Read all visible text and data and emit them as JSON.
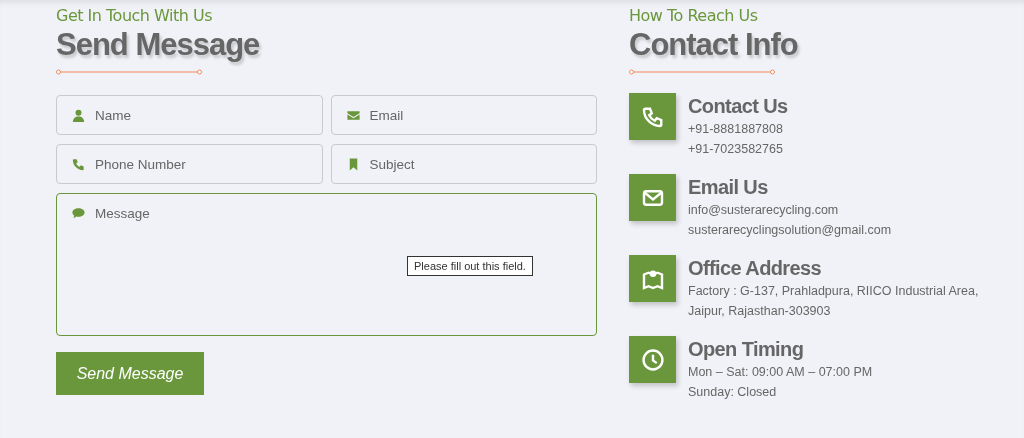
{
  "form": {
    "eyebrow": "Get In Touch With Us",
    "title": "Send Message",
    "fields": [
      {
        "kind": "input",
        "placeholder": "Name",
        "focused": false
      },
      {
        "kind": "input",
        "placeholder": "Email",
        "focused": false
      },
      {
        "kind": "input",
        "placeholder": "Phone Number",
        "focused": false
      },
      {
        "kind": "input",
        "placeholder": "Subject",
        "focused": false
      },
      {
        "kind": "textarea",
        "placeholder": "Message",
        "focused": true,
        "tooltip": "Please fill out this field."
      }
    ],
    "submit": "Send Message"
  },
  "contact": {
    "eyebrow": "How To Reach Us",
    "title": "Contact Info",
    "items": [
      {
        "kind": "phone",
        "title": "Contact Us",
        "lines": [
          "+91-8881887808",
          "+91-7023582765"
        ]
      },
      {
        "kind": "envelope",
        "title": "Email Us",
        "lines": [
          "info@susterarecycling.com",
          "susterarecyclingsolution@gmail.com"
        ]
      },
      {
        "kind": "map",
        "title": "Office Address",
        "lines": [
          "Factory : G-137, Prahladpura, RIICO Industrial Area,",
          "Jaipur, Rajasthan-303903"
        ]
      },
      {
        "kind": "clock",
        "title": "Open Timing",
        "lines": [
          "Mon – Sat: 09:00 AM – 07:00 PM",
          "Sunday: Closed"
        ]
      }
    ]
  }
}
